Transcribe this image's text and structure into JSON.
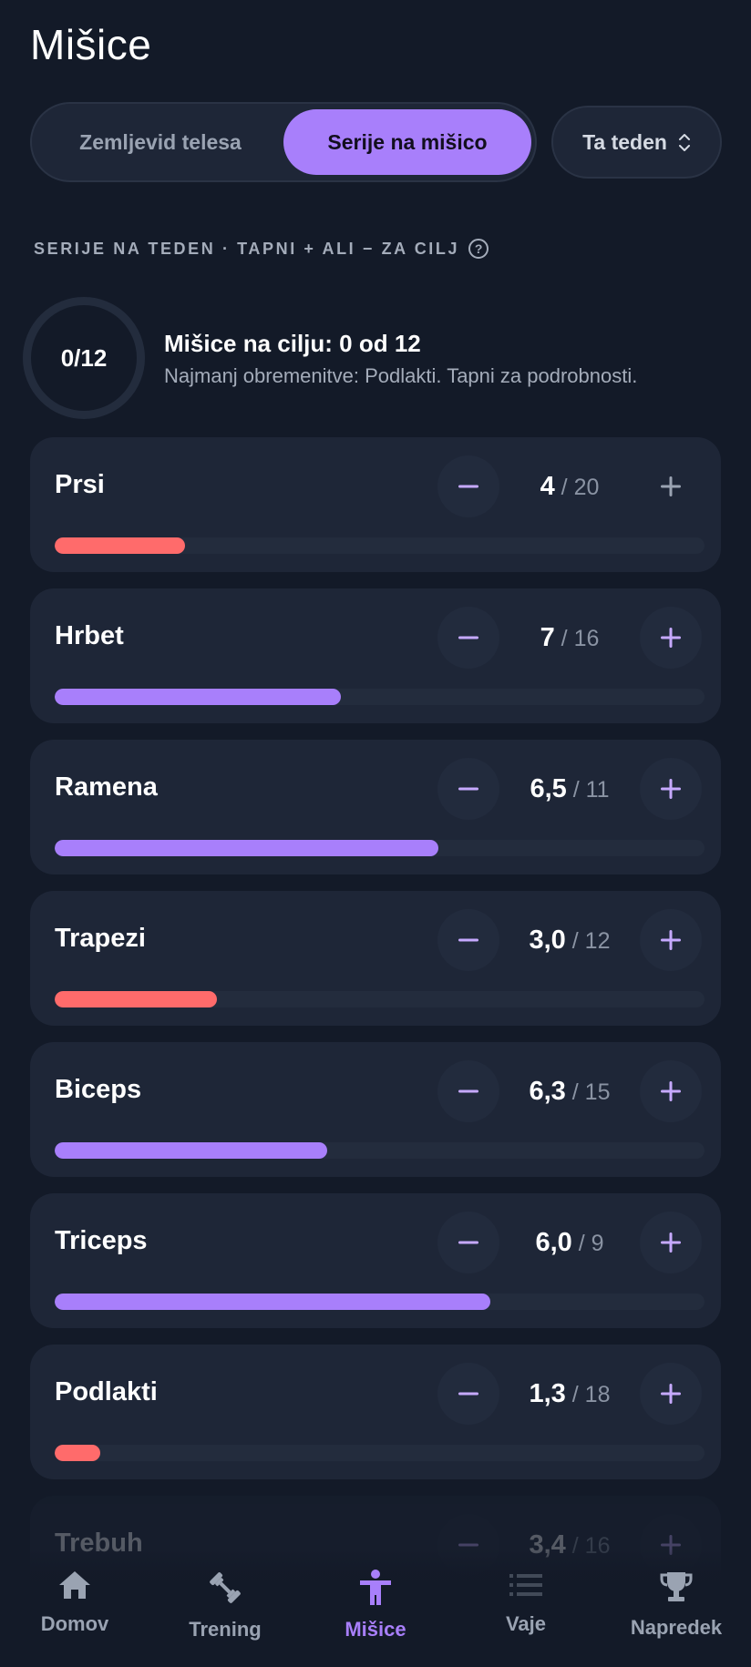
{
  "page": {
    "title": "Mišice"
  },
  "view_toggle": {
    "options": [
      "Zemljevid telesa",
      "Serije na mišico"
    ],
    "selected": "Serije na mišico"
  },
  "range_select": {
    "value": "Ta teden"
  },
  "section": {
    "label": "SERIJE NA TEDEN · TAPNI + ALI − ZA CILJ",
    "help_icon": "help-circle-icon",
    "help_glyph": "?"
  },
  "summary": {
    "ring_text": "0/12",
    "title": "Mišice na cilju: 0 od 12",
    "subtitle": "Najmanj obremenitve: Podlakti. Tapni za podrobnosti."
  },
  "colors": {
    "accent": "#a87ffb",
    "under_target": "#ff6b6b",
    "card_bg": "#1e2637",
    "page_bg": "#131a28"
  },
  "muscles": [
    {
      "name": "Prsi",
      "current": "4",
      "target": "20",
      "progress": 0.2,
      "status": "under"
    },
    {
      "name": "Hrbet",
      "current": "7",
      "target": "16",
      "progress": 0.44,
      "status": "ok"
    },
    {
      "name": "Ramena",
      "current": "6,5",
      "target": "11",
      "progress": 0.59,
      "status": "ok"
    },
    {
      "name": "Trapezi",
      "current": "3,0",
      "target": "12",
      "progress": 0.25,
      "status": "under"
    },
    {
      "name": "Biceps",
      "current": "6,3",
      "target": "15",
      "progress": 0.42,
      "status": "ok"
    },
    {
      "name": "Triceps",
      "current": "6,0",
      "target": "9",
      "progress": 0.67,
      "status": "ok"
    },
    {
      "name": "Podlakti",
      "current": "1,3",
      "target": "18",
      "progress": 0.07,
      "status": "under"
    },
    {
      "name": "Trebuh",
      "current": "3,4",
      "target": "16",
      "progress": 0.21,
      "status": "under"
    }
  ],
  "counter_separator": " / ",
  "nav": [
    {
      "label": "Domov",
      "icon": "home-icon",
      "active": false
    },
    {
      "label": "Trening",
      "icon": "dumbbell-icon",
      "active": false
    },
    {
      "label": "Mišice",
      "icon": "body-icon",
      "active": true
    },
    {
      "label": "Vaje",
      "icon": "list-icon",
      "active": false
    },
    {
      "label": "Napredek",
      "icon": "trophy-icon",
      "active": false
    }
  ]
}
